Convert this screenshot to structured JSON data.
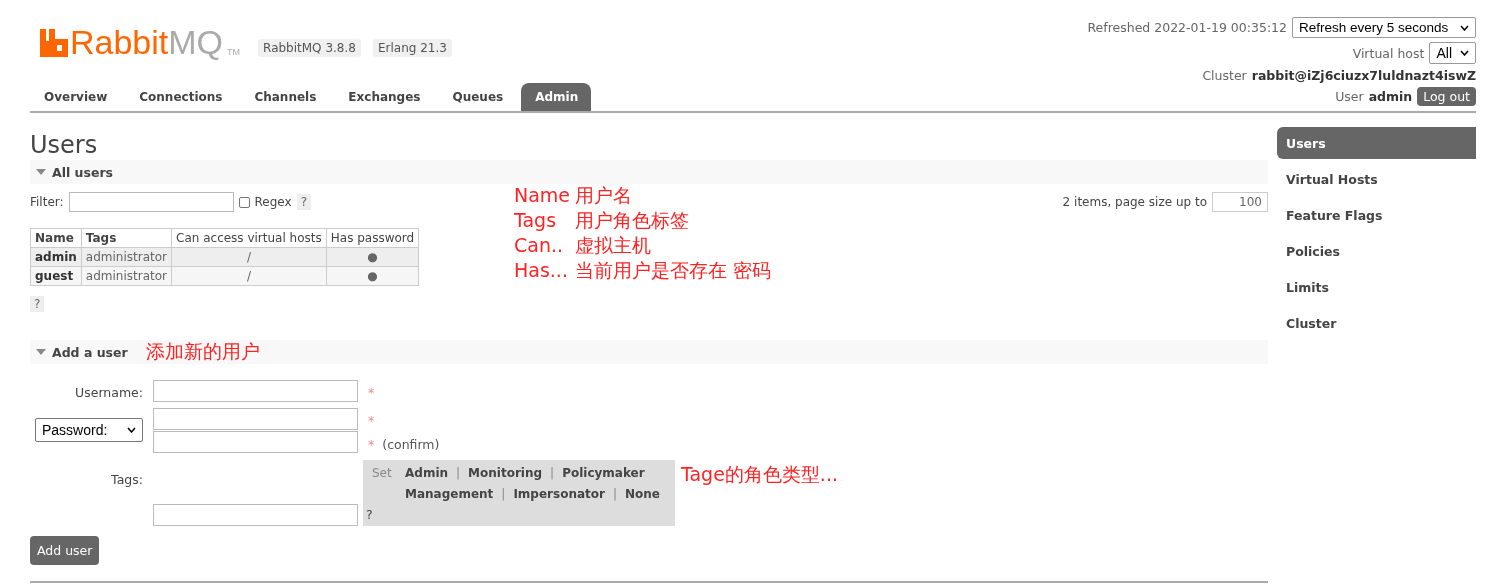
{
  "header": {
    "logo_main": "Rabbit",
    "logo_suffix": "MQ",
    "logo_tm": "TM",
    "versions": [
      "RabbitMQ 3.8.8",
      "Erlang 21.3"
    ],
    "refreshed": "Refreshed 2022-01-19 00:35:12",
    "refresh_select": "Refresh every 5 seconds",
    "vhost_label": "Virtual host",
    "vhost_select": "All",
    "cluster_label": "Cluster",
    "cluster_name": "rabbit@iZj6ciuzx7luldnazt4iswZ",
    "user_label": "User",
    "user_name": "admin",
    "logout": "Log out"
  },
  "tabs": [
    {
      "label": "Overview",
      "selected": false
    },
    {
      "label": "Connections",
      "selected": false
    },
    {
      "label": "Channels",
      "selected": false
    },
    {
      "label": "Exchanges",
      "selected": false
    },
    {
      "label": "Queues",
      "selected": false
    },
    {
      "label": "Admin",
      "selected": true
    }
  ],
  "page_title": "Users",
  "all_users": {
    "title": "All users",
    "expanded": true,
    "filter_label": "Filter:",
    "regex": {
      "label": "Regex",
      "checked": false
    },
    "regex_help": "?",
    "paging": "2 items, page size up to",
    "page_size": "100",
    "table": {
      "columns": [
        "Name",
        "Tags",
        "Can access virtual hosts",
        "Has password"
      ],
      "rows": [
        {
          "name": "admin",
          "tags": "administrator",
          "vhosts": "/",
          "has_password": "●"
        },
        {
          "name": "guest",
          "tags": "administrator",
          "vhosts": "/",
          "has_password": "●"
        }
      ]
    },
    "table_help": "?"
  },
  "annotations": [
    {
      "label": "Name",
      "note": "用户名"
    },
    {
      "label": "Tags",
      "note": "用户角色标签"
    },
    {
      "label": "Can..",
      "note": "虚拟主机"
    },
    {
      "label": "Has...",
      "note": "当前用户是否存在 密码"
    }
  ],
  "add_user": {
    "title": "Add a user",
    "expanded": true,
    "note": "添加新的用户",
    "username_label": "Username:",
    "password_select": "Password:",
    "required_marks": [
      "*",
      "*",
      "*"
    ],
    "confirm": "(confirm)",
    "tags_label": "Tags:",
    "tag_set_label": "Set",
    "tag_rows": [
      [
        {
          "kind": "tag",
          "text": "Admin"
        },
        {
          "kind": "separator",
          "text": "|"
        },
        {
          "kind": "tag",
          "text": "Monitoring"
        },
        {
          "kind": "separator",
          "text": "|"
        },
        {
          "kind": "tag",
          "text": "Policymaker"
        }
      ],
      [
        {
          "kind": "tag",
          "text": "Management"
        },
        {
          "kind": "separator",
          "text": "|"
        },
        {
          "kind": "tag",
          "text": "Impersonator"
        },
        {
          "kind": "separator",
          "text": "|"
        },
        {
          "kind": "tag",
          "text": "None"
        }
      ]
    ],
    "tags_help": "?",
    "tags_note": "Tage的角色类型...",
    "submit": "Add user"
  },
  "sidebar": [
    {
      "label": "Users",
      "selected": true
    },
    {
      "label": "Virtual Hosts",
      "selected": false
    },
    {
      "label": "Feature Flags",
      "selected": false
    },
    {
      "label": "Policies",
      "selected": false
    },
    {
      "label": "Limits",
      "selected": false
    },
    {
      "label": "Cluster",
      "selected": false
    }
  ]
}
